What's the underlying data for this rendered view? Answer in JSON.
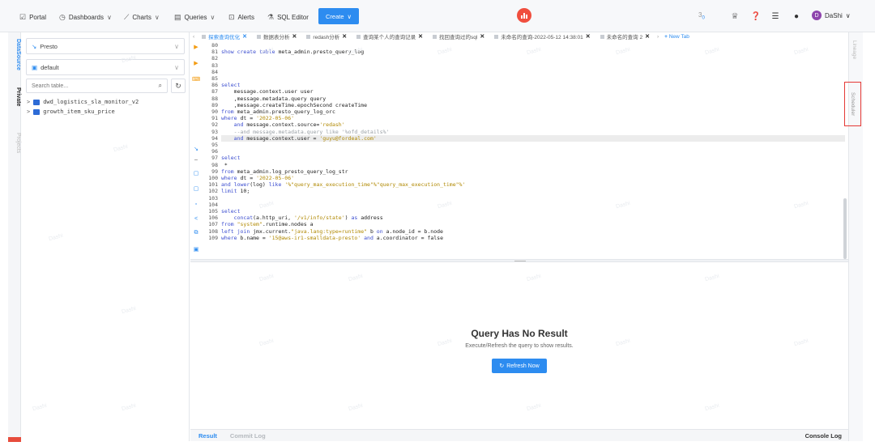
{
  "nav": {
    "portal": "Portal",
    "dashboards": "Dashboards",
    "charts": "Charts",
    "queries": "Queries",
    "alerts": "Alerts",
    "sql_editor": "SQL Editor",
    "create": "Create",
    "count": "3",
    "count_sub": "0",
    "user": "DaShi",
    "avatar_letter": "D"
  },
  "left_rail": {
    "datasource": "DataSource",
    "private": "Private",
    "projects": "Projects"
  },
  "schema": {
    "datasource_value": "Presto",
    "database_value": "default",
    "search_placeholder": "Search table...",
    "tables": [
      "dwd_logistics_sla_monitor_v2",
      "growth_item_sku_price"
    ]
  },
  "tabs": [
    {
      "label": "探索查询优化",
      "active": true
    },
    {
      "label": "数据表分析",
      "active": false
    },
    {
      "label": "redash分析",
      "active": false
    },
    {
      "label": "查询某个人的查询记录",
      "active": false
    },
    {
      "label": "找回查询过的sql",
      "active": false
    },
    {
      "label": "未命名的查询-2022-05-12 14:38:01",
      "active": false
    },
    {
      "label": "未命名的查询 2",
      "active": false
    }
  ],
  "new_tab": "New Tab",
  "code_lines": [
    {
      "n": "80",
      "t": ""
    },
    {
      "n": "81",
      "t": "show create table meta_admin.presto_query_log"
    },
    {
      "n": "82",
      "t": ""
    },
    {
      "n": "83",
      "t": ""
    },
    {
      "n": "84",
      "t": ""
    },
    {
      "n": "85",
      "t": ""
    },
    {
      "n": "86",
      "t": "select"
    },
    {
      "n": "87",
      "t": "    message.context.user user"
    },
    {
      "n": "88",
      "t": "    ,message.metadata.query query"
    },
    {
      "n": "89",
      "t": "    ,message.createTime.epochSecond createTime"
    },
    {
      "n": "90",
      "t": "from meta_admin.presto_query_log_orc"
    },
    {
      "n": "91",
      "t": "where dt = '2022-05-06'"
    },
    {
      "n": "92",
      "t": "    and message.context.source='redash'"
    },
    {
      "n": "93",
      "t": "    --and message.metadata.query like '%ofd_details%'"
    },
    {
      "n": "94",
      "t": "    and message.context.user = 'guyu@fordeal.com'"
    },
    {
      "n": "95",
      "t": ""
    },
    {
      "n": "96",
      "t": ""
    },
    {
      "n": "97",
      "t": "select"
    },
    {
      "n": "98",
      "t": " *"
    },
    {
      "n": "99",
      "t": "from meta_admin.log_presto_query_log_str"
    },
    {
      "n": "100",
      "t": "where dt = '2022-05-06'"
    },
    {
      "n": "101",
      "t": "and lower(log) like '%\"query_max_execution_time\"%\"query_max_execution_time\"%'"
    },
    {
      "n": "102",
      "t": "limit 10;"
    },
    {
      "n": "103",
      "t": ""
    },
    {
      "n": "104",
      "t": ""
    },
    {
      "n": "105",
      "t": "select"
    },
    {
      "n": "106",
      "t": "    concat(a.http_uri, '/v1/info/state') as address"
    },
    {
      "n": "107",
      "t": "from \"system\".runtime.nodes a"
    },
    {
      "n": "108",
      "t": "left join jmx.current.\"java.lang:type=runtime\" b on a.node_id = b.node"
    },
    {
      "n": "109",
      "t": "where b.name = '15@aws-ir1-smalldata-presto' and a.coordinator = false"
    }
  ],
  "result": {
    "title": "Query Has No Result",
    "subtitle": "Execute/Refresh the query to show results.",
    "refresh_button": "Refresh Now",
    "tab_result": "Result",
    "tab_commit_log": "Commit Log",
    "console_log": "Console Log"
  },
  "right_rail": {
    "lineage": "Lineage",
    "scheduler": "Scheduler"
  },
  "colors": {
    "accent": "#2d8cf0",
    "highlight_box": "#e53935",
    "logo": "#f04e3e"
  }
}
